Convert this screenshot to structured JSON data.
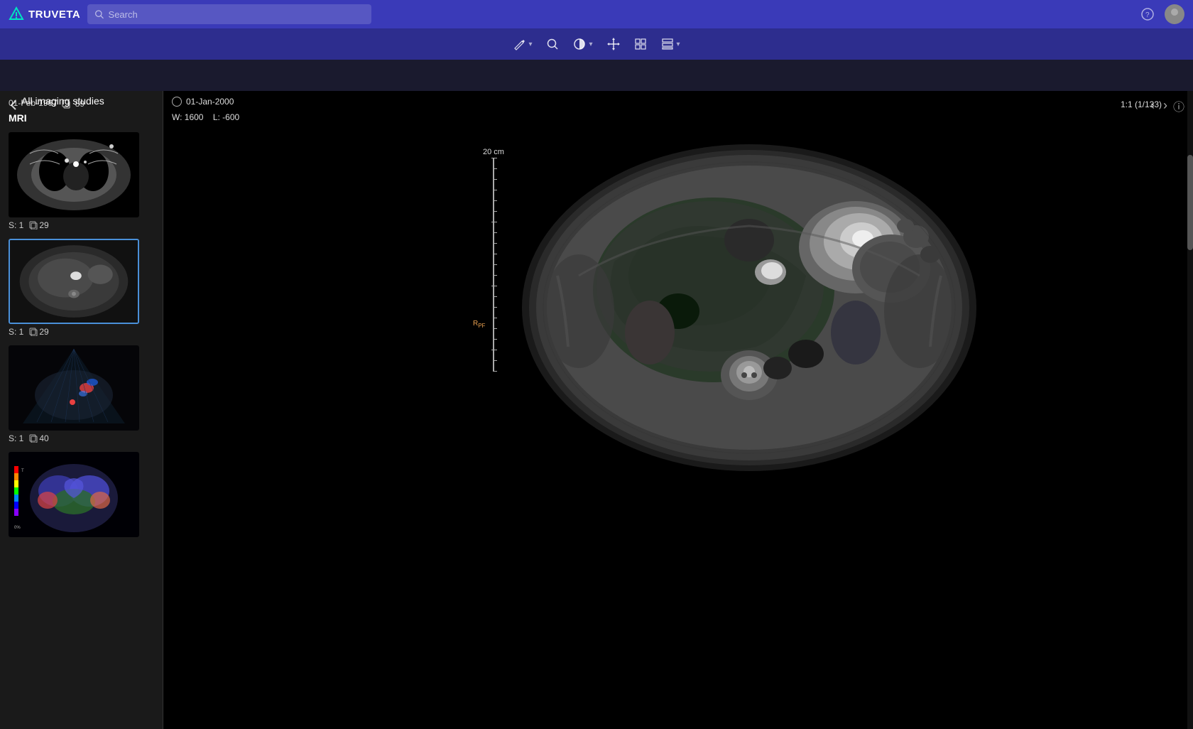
{
  "app": {
    "name": "TRUVETA"
  },
  "topnav": {
    "logo_text": "TRUVETA",
    "search_placeholder": "Search",
    "help_icon": "?",
    "user_icon": "user-avatar"
  },
  "toolbar": {
    "tools": [
      {
        "id": "pen",
        "icon": "✏",
        "has_dropdown": true
      },
      {
        "id": "magnify",
        "icon": "🔍",
        "has_dropdown": false
      },
      {
        "id": "contrast",
        "icon": "◑",
        "has_dropdown": true
      },
      {
        "id": "move",
        "icon": "✛",
        "has_dropdown": false
      },
      {
        "id": "grid4",
        "icon": "⊞",
        "has_dropdown": false
      },
      {
        "id": "grid2",
        "icon": "▤",
        "has_dropdown": true
      }
    ]
  },
  "subheader": {
    "back_label": "‹",
    "title": "All imaging studies"
  },
  "sidebar": {
    "date": "01-Feb-1967",
    "copy_count": "89",
    "modality": "MRI",
    "studies": [
      {
        "id": "study-1",
        "series": "S: 1",
        "frames": "29",
        "type": "ct-chest",
        "selected": false
      },
      {
        "id": "study-2",
        "series": "S: 1",
        "frames": "29",
        "type": "mri-abdomen",
        "selected": true
      },
      {
        "id": "study-3",
        "series": "S: 1",
        "frames": "40",
        "type": "ultrasound",
        "selected": false
      },
      {
        "id": "study-4",
        "series": "",
        "frames": "",
        "type": "brain-color",
        "selected": false
      }
    ]
  },
  "viewer": {
    "date": "01-Jan-2000",
    "window_width": "W: 1600",
    "window_level": "L: -600",
    "page_info": "1:1 (1/133)",
    "ruler_label": "20 cm",
    "ruler_marker": "R PF"
  }
}
